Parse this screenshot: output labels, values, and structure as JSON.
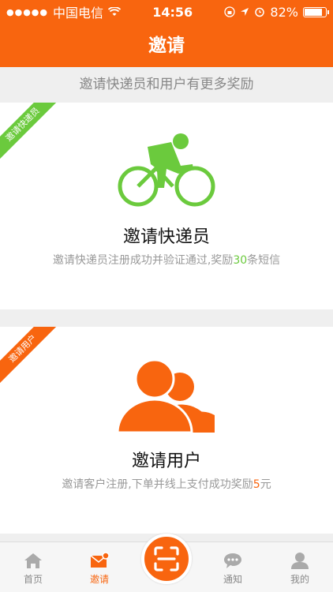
{
  "status_bar": {
    "carrier": "中国电信",
    "time": "14:56",
    "battery": "82%"
  },
  "header": {
    "title": "邀请"
  },
  "subtitle": "邀请快递员和用户有更多奖励",
  "courier_card": {
    "ribbon": "邀请快递员",
    "title": "邀请快递员",
    "desc_prefix": "邀请快递员注册成功并验证通过,奖励",
    "desc_highlight": "30",
    "desc_suffix": "条短信",
    "icon": "cyclist-icon",
    "accent": "#6bca3d"
  },
  "user_card": {
    "ribbon": "邀请用户",
    "title": "邀请用户",
    "desc_prefix": "邀请客户注册,下单并线上支付成功奖励",
    "desc_highlight": "5",
    "desc_suffix": "元",
    "icon": "users-icon",
    "accent": "#f8650f"
  },
  "tabbar": {
    "home": "首页",
    "invite": "邀请",
    "scan": "scan-icon",
    "notify": "通知",
    "mine": "我的"
  }
}
